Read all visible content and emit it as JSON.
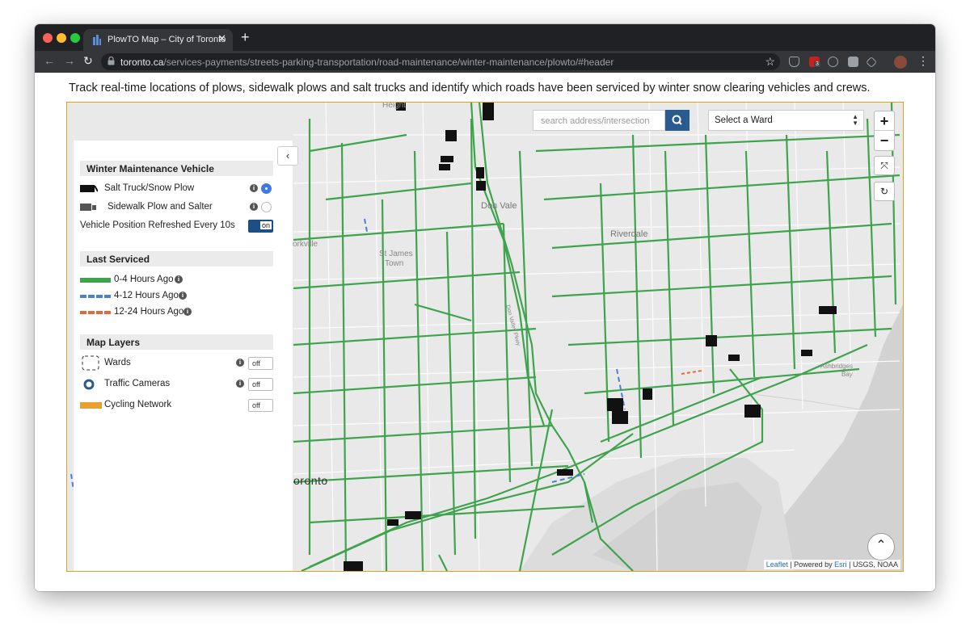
{
  "browser": {
    "tab_title": "PlowTO Map – City of Toronto",
    "tab_close": "✕",
    "new_tab": "+",
    "url_host": "toronto.ca",
    "url_path": "/services-payments/streets-parking-transportation/road-maintenance/winter-maintenance/plowto/#header",
    "back": "←",
    "forward": "→",
    "reload": "↻",
    "bookmark_star": "☆",
    "menu": "⋮",
    "ext_badge": "3"
  },
  "intro_text": "Track real-time locations of plows, sidewalk plows and salt trucks and identify which roads have been serviced by winter snow clearing vehicles and crews.",
  "map": {
    "search_placeholder": "search address/intersection",
    "ward_select": "Select a Ward",
    "zoom_in": "+",
    "zoom_out": "−",
    "fullscreen": "⤧",
    "refresh": "↻",
    "collapse": "‹",
    "attribution": {
      "leaflet": "Leaflet",
      "powered": "| Powered by",
      "esri": "Esri",
      "sources": "| USGS, NOAA"
    },
    "places": {
      "heights": "Height",
      "don_vale": "Don Vale",
      "riverdale": "Riverdale",
      "st_james": "St James",
      "town": "Town",
      "yorkville": "orkville",
      "toronto": "oronto",
      "ashbridges": "Ashbridges",
      "bay": "Bay",
      "dvp": "Don Valley Pkwy"
    }
  },
  "panel": {
    "vehicle_title": "Winter Maintenance Vehicle",
    "salt_truck": "Salt Truck/Snow Plow",
    "sidewalk_plow": "Sidewalk Plow and Salter",
    "refresh_label": "Vehicle Position Refreshed Every 10s",
    "refresh_toggle": "on",
    "last_serviced_title": "Last Serviced",
    "range1": "0-4 Hours Ago",
    "range2": "4-12 Hours Ago",
    "range3": "12-24 Hours Ago",
    "layers_title": "Map Layers",
    "wards": "Wards",
    "wards_toggle": "off",
    "cameras": "Traffic Cameras",
    "cameras_toggle": "off",
    "cycling": "Cycling Network",
    "cycling_toggle": "off",
    "info_glyph": "i"
  },
  "colors": {
    "green": "#3fa34d",
    "blue": "#4a7fd8",
    "orange": "#e06a3a",
    "cycling": "#e8a030",
    "accent": "#2b5b8e"
  },
  "scroll_top": "⌃"
}
